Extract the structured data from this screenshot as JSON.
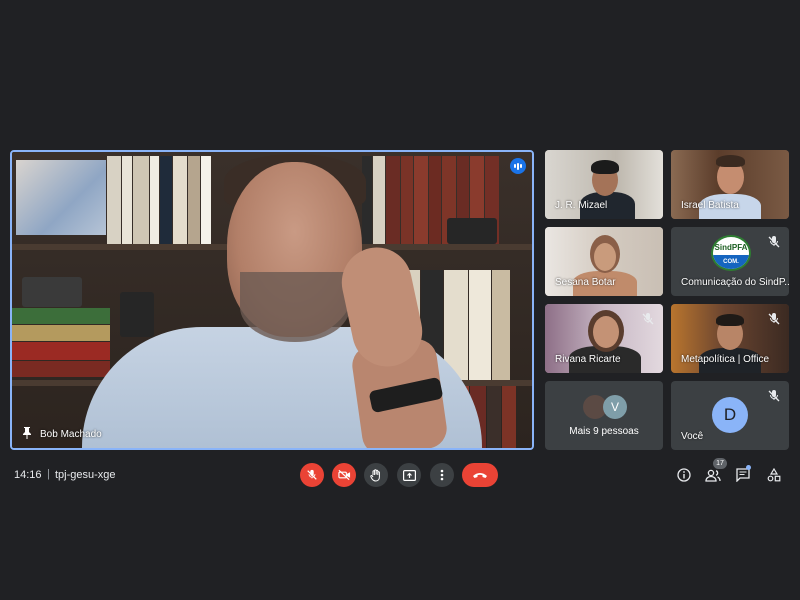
{
  "meeting": {
    "time": "14:16",
    "separator": "|",
    "code": "tpj-gesu-xge",
    "people_count": "17"
  },
  "main_tile": {
    "name": "Bob Machado"
  },
  "tiles": [
    {
      "name": "J. R. Mizael"
    },
    {
      "name": "Israel Batista"
    },
    {
      "name": "Sesana Botar"
    },
    {
      "name": "Comunicação do SindP..."
    },
    {
      "name": "Rivana Ricarte"
    },
    {
      "name": "Metapolítica | Office"
    },
    {
      "name": "Mais 9 pessoas",
      "avatar_letter": "V"
    },
    {
      "name": "Você",
      "avatar_letter": "D"
    }
  ],
  "logo": {
    "line1": "SindPFA",
    "line2": "COM."
  },
  "colors": {
    "background": "#202124",
    "tile": "#3c4043",
    "active_border": "#8ab4f8",
    "danger": "#ea4335",
    "accent": "#1a73e8"
  },
  "controls": [
    {
      "icon": "mic-off-icon",
      "state": "red"
    },
    {
      "icon": "camera-off-icon",
      "state": "red"
    },
    {
      "icon": "raise-hand-icon",
      "state": "grey"
    },
    {
      "icon": "present-screen-icon",
      "state": "grey"
    },
    {
      "icon": "more-options-icon",
      "state": "grey"
    },
    {
      "icon": "end-call-icon",
      "state": "red"
    }
  ],
  "right_icons": [
    "info-icon",
    "people-icon",
    "chat-icon",
    "activities-icon"
  ]
}
